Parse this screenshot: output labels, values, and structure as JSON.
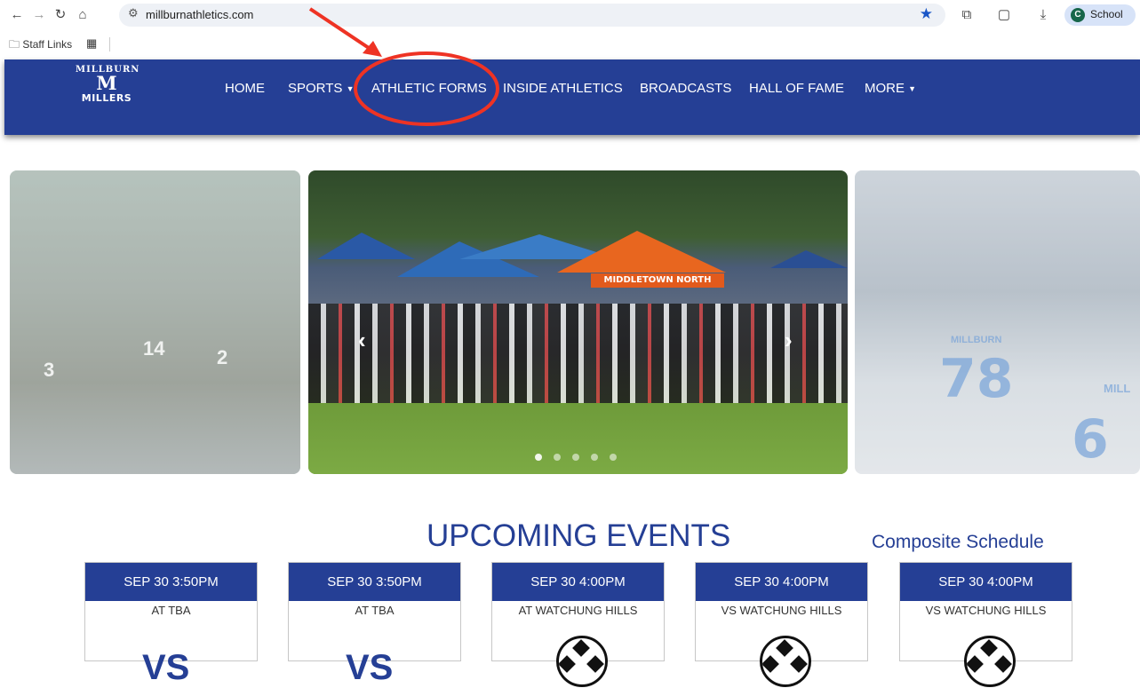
{
  "browser": {
    "url": "millburnathletics.com",
    "profile_initial": "C",
    "profile_name": "School",
    "bookmarks": [
      {
        "label": "Staff Links",
        "icon": "folder-link-icon"
      },
      {
        "label": "",
        "icon": "apps-grid-icon"
      }
    ]
  },
  "site": {
    "logo": {
      "top": "MILLBURN",
      "letter": "M",
      "bottom": "MILLERS"
    },
    "nav": [
      {
        "label": "HOME",
        "dropdown": false
      },
      {
        "label": "SPORTS",
        "dropdown": true
      },
      {
        "label": "ATHLETIC FORMS",
        "dropdown": false
      },
      {
        "label": "INSIDE ATHLETICS",
        "dropdown": false
      },
      {
        "label": "BROADCASTS",
        "dropdown": false
      },
      {
        "label": "HALL OF FAME",
        "dropdown": false
      },
      {
        "label": "MORE",
        "dropdown": true
      }
    ],
    "nav_bg": "#253f95"
  },
  "annotation": {
    "highlighted_item": "ATHLETIC FORMS",
    "color": "#ee3324"
  },
  "carousel": {
    "main_banner_text": "MIDDLETOWN NORTH",
    "left_jersey_numbers": [
      "3",
      "14",
      "2"
    ],
    "right_jersey_numbers": [
      "78",
      "6"
    ],
    "right_jersey_text": [
      "MILL",
      "MILLBURN"
    ],
    "slide_count": 5,
    "active_slide": 1
  },
  "events": {
    "title": "UPCOMING EVENTS",
    "composite_link": "Composite Schedule",
    "cards": [
      {
        "date": "SEP 30 3:50PM",
        "opponent": "AT TBA",
        "graphic": "vs-text"
      },
      {
        "date": "SEP 30 3:50PM",
        "opponent": "AT TBA",
        "graphic": "vs-text"
      },
      {
        "date": "SEP 30 4:00PM",
        "opponent": "AT WATCHUNG HILLS",
        "graphic": "soccer-ball"
      },
      {
        "date": "SEP 30 4:00PM",
        "opponent": "VS WATCHUNG HILLS",
        "graphic": "soccer-ball"
      },
      {
        "date": "SEP 30 4:00PM",
        "opponent": "VS WATCHUNG HILLS",
        "graphic": "soccer-ball"
      }
    ],
    "vs_label": "VS"
  }
}
